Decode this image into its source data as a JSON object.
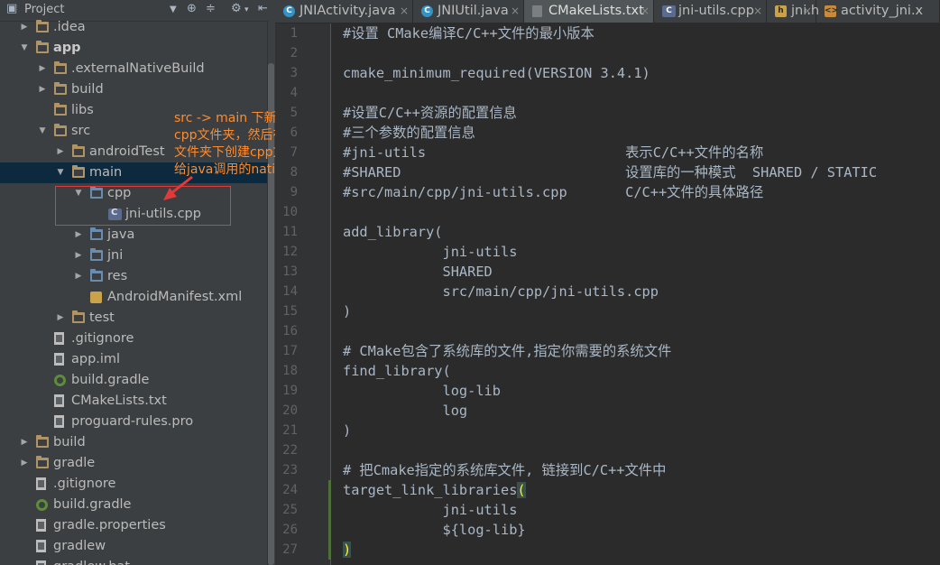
{
  "project_panel": {
    "title": "Project",
    "items": [
      {
        "label": ".idea",
        "icon": "folder-icon",
        "arrow": "right"
      },
      {
        "label": "app",
        "icon": "folder-icon",
        "arrow": "down",
        "bold": true
      },
      {
        "label": ".externalNativeBuild",
        "icon": "folder-icon",
        "arrow": "right"
      },
      {
        "label": "build",
        "icon": "folder-icon",
        "arrow": "right"
      },
      {
        "label": "libs",
        "icon": "folder-icon",
        "arrow": ""
      },
      {
        "label": "src",
        "icon": "folder-icon",
        "arrow": "down"
      },
      {
        "label": "androidTest",
        "icon": "folder-icon",
        "arrow": "right"
      },
      {
        "label": "main",
        "icon": "folder-icon",
        "arrow": "down",
        "selected": true
      },
      {
        "label": "cpp",
        "icon": "source-folder-icon",
        "arrow": "down"
      },
      {
        "label": "jni-utils.cpp",
        "icon": "cpp-file-icon",
        "arrow": ""
      },
      {
        "label": "java",
        "icon": "source-folder-icon",
        "arrow": "right"
      },
      {
        "label": "jni",
        "icon": "source-folder-icon",
        "arrow": "right"
      },
      {
        "label": "res",
        "icon": "resource-folder-icon",
        "arrow": "right"
      },
      {
        "label": "AndroidManifest.xml",
        "icon": "manifest-file-icon",
        "arrow": ""
      },
      {
        "label": "test",
        "icon": "folder-icon",
        "arrow": "right"
      },
      {
        "label": ".gitignore",
        "icon": "file-icon",
        "arrow": ""
      },
      {
        "label": "app.iml",
        "icon": "file-icon",
        "arrow": ""
      },
      {
        "label": "build.gradle",
        "icon": "gradle-file-icon",
        "arrow": ""
      },
      {
        "label": "CMakeLists.txt",
        "icon": "file-icon",
        "arrow": ""
      },
      {
        "label": "proguard-rules.pro",
        "icon": "file-icon",
        "arrow": ""
      },
      {
        "label": "build",
        "icon": "folder-icon",
        "arrow": "right"
      },
      {
        "label": "gradle",
        "icon": "folder-icon",
        "arrow": "right"
      },
      {
        "label": ".gitignore",
        "icon": "file-icon",
        "arrow": ""
      },
      {
        "label": "build.gradle",
        "icon": "gradle-file-icon",
        "arrow": ""
      },
      {
        "label": "gradle.properties",
        "icon": "file-icon",
        "arrow": ""
      },
      {
        "label": "gradlew",
        "icon": "file-icon",
        "arrow": ""
      },
      {
        "label": "gradlew.bat",
        "icon": "file-icon",
        "arrow": ""
      }
    ]
  },
  "annotation": {
    "lines": [
      "src -> main 下新建",
      "cpp文件夹，然后在该",
      "文件夹下创建cpp文件",
      "给java调用的native代码"
    ],
    "color": "#ff8b2c"
  },
  "tabs": [
    {
      "label": "JNIActivity.java",
      "icon": "java-class-icon",
      "active": false
    },
    {
      "label": "JNIUtil.java",
      "icon": "java-class-icon",
      "active": false
    },
    {
      "label": "CMakeLists.txt",
      "icon": "text-file-icon",
      "active": true
    },
    {
      "label": "jni-utils.cpp",
      "icon": "cpp-file-icon",
      "active": false
    },
    {
      "label": "jni.h",
      "icon": "header-file-icon",
      "active": false
    },
    {
      "label": "activity_jni.x",
      "icon": "xml-file-icon",
      "active": false
    }
  ],
  "editor": {
    "lines": [
      "#设置 CMake编译C/C++文件的最小版本",
      "",
      "cmake_minimum_required(VERSION 3.4.1)",
      "",
      "#设置C/C++资源的配置信息",
      "#三个参数的配置信息",
      "#jni-utils                        表示C/C++文件的名称",
      "#SHARED                           设置库的一种模式  SHARED / STATIC",
      "#src/main/cpp/jni-utils.cpp       C/C++文件的具体路径",
      "",
      "add_library(",
      "            jni-utils",
      "            SHARED",
      "            src/main/cpp/jni-utils.cpp",
      ")",
      "",
      "# CMake包含了系统库的文件,指定你需要的系统文件",
      "find_library(",
      "            log-lib",
      "            log",
      ")",
      "",
      "# 把Cmake指定的系统库文件, 链接到C/C++文件中",
      "target_link_libraries(",
      "            jni-utils",
      "            ${log-lib}",
      ")"
    ],
    "line_numbers": [
      "1",
      "2",
      "3",
      "4",
      "5",
      "6",
      "7",
      "8",
      "9",
      "10",
      "11",
      "12",
      "13",
      "14",
      "15",
      "16",
      "17",
      "18",
      "19",
      "20",
      "21",
      "22",
      "23",
      "24",
      "25",
      "26",
      "27"
    ]
  }
}
